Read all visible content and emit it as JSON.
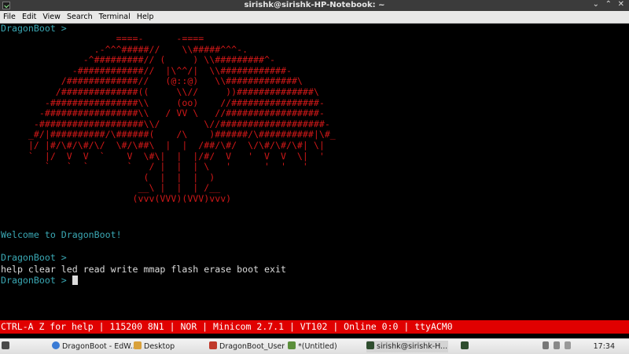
{
  "window": {
    "title": "sirishk@sirishk-HP-Notebook: ~",
    "minimize": "⌄",
    "maximize": "⌃",
    "close": "✕"
  },
  "menu": [
    "File",
    "Edit",
    "View",
    "Search",
    "Terminal",
    "Help"
  ],
  "terminal": {
    "prompt1": "DragonBoot >",
    "art": "                     ====-      -====\n                 .-^^^#####//    \\\\#####^^^-.\n               -^#########// (     ) \\\\#########^-\n             -############//  |\\^^/|  \\\\############-\n           /#############//   (@::@)   \\\\#############\\\n          /##############((     \\\\//     ))##############\\\n        -################\\\\     (oo)    //################-\n       -#################\\\\   / VV \\   //#################-\n      -###################\\\\/        \\//###################-\n     _#/|##########/\\######(    /\\    )######/\\##########|\\#_\n     |/ |#/\\#/\\#/\\/  \\#/\\##\\  |  |  /##/\\#/  \\/\\#/\\#/\\#| \\|\n     `  |/  V  V  `    V  \\#\\|  |  |/#/  V   '  V  V  \\|  '\n        `   `  `       `   / |  |  | \\   '      '  '   '\n                          (  |  |  |  )\n                         __\\ |  |  | /__\n                        (vvv(VVV)(VVV)vvv)",
    "welcome": "Welcome to DragonBoot!",
    "prompt2": "DragonBoot >",
    "commands": "help clear led read write mmap flash erase boot exit",
    "prompt3": "DragonBoot >"
  },
  "status_bar": "CTRL-A Z for help | 115200 8N1 | NOR | Minicom 2.7.1 | VT102 | Online 0:0 | ttyACM0",
  "taskbar": {
    "items": [
      {
        "label": "DragonBoot - EdW...",
        "icon_color": "#3a7bd5"
      },
      {
        "label": "Desktop",
        "icon_color": "#d9a13b"
      },
      {
        "label": "DragonBoot_User...",
        "icon_color": "#c0392b"
      },
      {
        "label": "*(Untitled)",
        "icon_color": "#5b8f3b"
      },
      {
        "label": "sirishk@sirishk-H...",
        "icon_color": "#2e4d2e"
      },
      {
        "label": "",
        "icon_color": "#2e4d2e"
      }
    ],
    "clock": "17:34"
  }
}
